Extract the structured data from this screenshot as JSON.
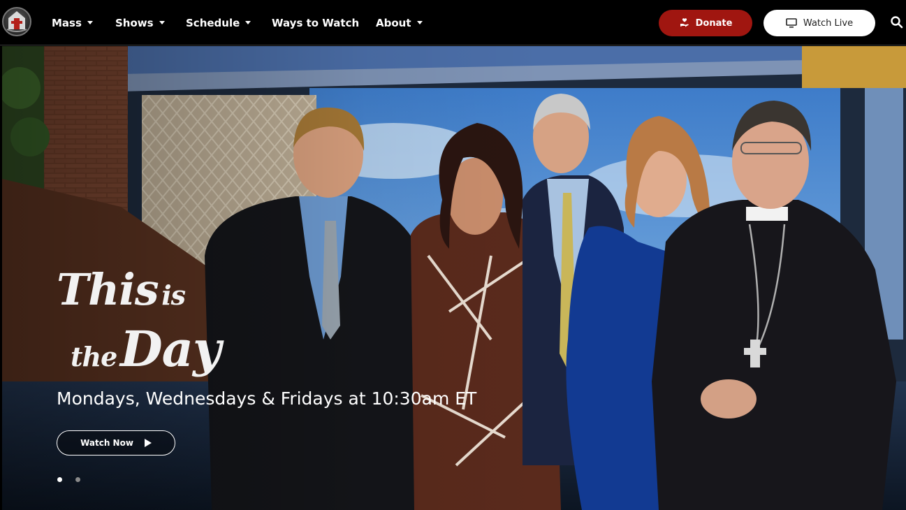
{
  "nav": {
    "items": [
      {
        "label": "Mass",
        "dropdown": true
      },
      {
        "label": "Shows",
        "dropdown": true
      },
      {
        "label": "Schedule",
        "dropdown": true
      },
      {
        "label": "Ways to Watch",
        "dropdown": false
      },
      {
        "label": "About",
        "dropdown": true
      }
    ],
    "donate_label": "Donate",
    "watch_live_label": "Watch Live",
    "icons": {
      "logo": "church-logo-icon",
      "donate": "hand-heart-icon",
      "live": "monitor-icon",
      "search": "search-icon"
    }
  },
  "hero": {
    "title": {
      "this": "This",
      "is": "is",
      "the": "the",
      "day": "Day"
    },
    "schedule": "Mondays, Wednesdays & Fridays at 10:30am ET",
    "cta_label": "Watch Now",
    "slides_total": 2,
    "active_slide": 1
  },
  "colors": {
    "nav_bg": "#000000",
    "donate": "#a01610",
    "watch_live_bg": "#ffffff"
  }
}
